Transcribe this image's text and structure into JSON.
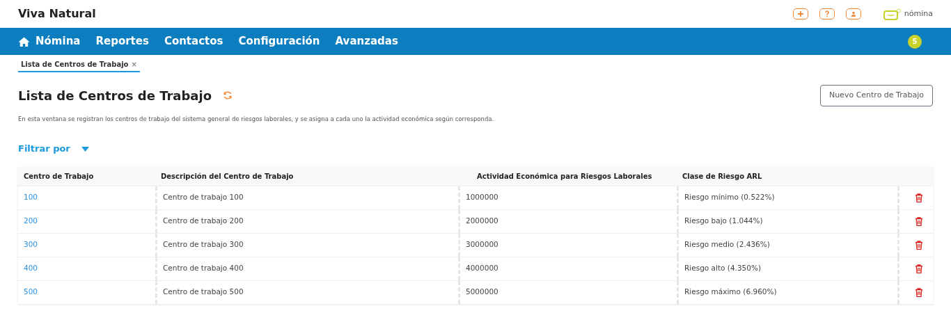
{
  "app_title": "Viva Natural",
  "header_icons": [
    {
      "kind": "plus"
    },
    {
      "kind": "help"
    },
    {
      "kind": "user"
    }
  ],
  "product": {
    "label": "nómina"
  },
  "nav": {
    "items": [
      {
        "label": "Nómina",
        "kind": "home"
      },
      {
        "label": "Reportes",
        "kind": "text"
      },
      {
        "label": "Contactos",
        "kind": "text"
      },
      {
        "label": "Configuración",
        "kind": "text"
      },
      {
        "label": "Avanzadas",
        "kind": "text"
      }
    ],
    "badge": "5"
  },
  "open_tabs": [
    {
      "label": "Lista de Centros de Trabajo",
      "close": "×",
      "selected": true
    }
  ],
  "page": {
    "title": "Lista de Centros de Trabajo",
    "new_button": "Nuevo Centro de Trabajo",
    "description": "En esta ventana se registran los centros de trabajo del sistema general de riesgos laborales, y se asigna a cada uno la actividad económica según corresponda.",
    "filter": "Filtrar por"
  },
  "table": {
    "columns": [
      "Centro de Trabajo",
      "Descripción del Centro de Trabajo",
      "Actividad Económica para Riesgos Laborales",
      "Clase de Riesgo ARL"
    ],
    "rows": [
      {
        "code": "100",
        "description": "Centro de trabajo 100",
        "activity": "1000000",
        "risk": "Riesgo mínimo (0.522%)"
      },
      {
        "code": "200",
        "description": "Centro de trabajo 200",
        "activity": "2000000",
        "risk": "Riesgo bajo (1.044%)"
      },
      {
        "code": "300",
        "description": "Centro de trabajo 300",
        "activity": "3000000",
        "risk": "Riesgo medio (2.436%)"
      },
      {
        "code": "400",
        "description": "Centro de trabajo 400",
        "activity": "4000000",
        "risk": "Riesgo alto (4.350%)"
      },
      {
        "code": "500",
        "description": "Centro de trabajo 500",
        "activity": "5000000",
        "risk": "Riesgo máximo (6.960%)"
      }
    ]
  }
}
